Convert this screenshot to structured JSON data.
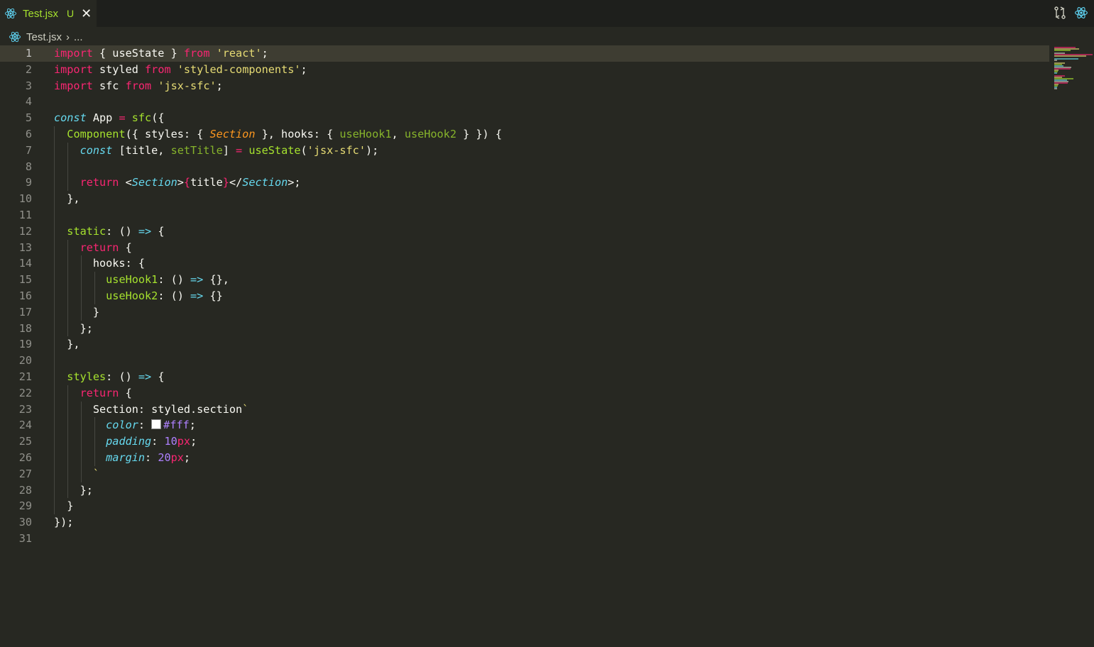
{
  "tab": {
    "file_name": "Test.jsx",
    "status": "U",
    "close_glyph": "✕",
    "icon": "react-icon"
  },
  "breadcrumb": {
    "file_name": "Test.jsx",
    "separator": "›",
    "more": "..."
  },
  "top_actions": [
    {
      "icon": "source-control-compare-icon"
    },
    {
      "icon": "react-icon"
    }
  ],
  "editor": {
    "current_line": 1,
    "lines": [
      {
        "n": "1",
        "tokens": [
          [
            "k",
            "import"
          ],
          [
            "p",
            " { useState } "
          ],
          [
            "k",
            "from"
          ],
          [
            "p",
            " "
          ],
          [
            "s",
            "'react'"
          ],
          [
            "p",
            ";"
          ]
        ]
      },
      {
        "n": "2",
        "tokens": [
          [
            "k",
            "import"
          ],
          [
            "p",
            " styled "
          ],
          [
            "k",
            "from"
          ],
          [
            "p",
            " "
          ],
          [
            "s",
            "'styled-components'"
          ],
          [
            "p",
            ";"
          ]
        ]
      },
      {
        "n": "3",
        "tokens": [
          [
            "k",
            "import"
          ],
          [
            "p",
            " sfc "
          ],
          [
            "k",
            "from"
          ],
          [
            "p",
            " "
          ],
          [
            "s",
            "'jsx-sfc'"
          ],
          [
            "p",
            ";"
          ]
        ]
      },
      {
        "n": "4",
        "tokens": []
      },
      {
        "n": "5",
        "tokens": [
          [
            "c",
            "const"
          ],
          [
            "p",
            " App "
          ],
          [
            "k",
            "="
          ],
          [
            "p",
            " "
          ],
          [
            "gr",
            "sfc"
          ],
          [
            "p",
            "({"
          ]
        ]
      },
      {
        "n": "6",
        "tokens": [
          [
            "p",
            "  "
          ],
          [
            "gr",
            "Component"
          ],
          [
            "p",
            "({ styles: { "
          ],
          [
            "o",
            "Section"
          ],
          [
            "p",
            " }, hooks: { "
          ],
          [
            "g",
            "useHook1"
          ],
          [
            "p",
            ", "
          ],
          [
            "g",
            "useHook2"
          ],
          [
            "p",
            " }"
          ],
          [
            "p",
            " }) {"
          ]
        ]
      },
      {
        "n": "7",
        "tokens": [
          [
            "p",
            "    "
          ],
          [
            "c",
            "const"
          ],
          [
            "p",
            " [title, "
          ],
          [
            "g",
            "setTitle"
          ],
          [
            "p",
            "] "
          ],
          [
            "k",
            "="
          ],
          [
            "p",
            " "
          ],
          [
            "gr",
            "useState"
          ],
          [
            "p",
            "("
          ],
          [
            "s",
            "'jsx-sfc'"
          ],
          [
            "p",
            ");"
          ]
        ]
      },
      {
        "n": "8",
        "tokens": []
      },
      {
        "n": "9",
        "tokens": [
          [
            "p",
            "    "
          ],
          [
            "k",
            "return"
          ],
          [
            "p",
            " <"
          ],
          [
            "c",
            "Section"
          ],
          [
            "p",
            ">"
          ],
          [
            "br",
            "{"
          ],
          [
            "p",
            "title"
          ],
          [
            "br",
            "}"
          ],
          [
            "p",
            "</"
          ],
          [
            "c",
            "Section"
          ],
          [
            "p",
            ">;"
          ]
        ]
      },
      {
        "n": "10",
        "tokens": [
          [
            "p",
            "  },"
          ]
        ]
      },
      {
        "n": "11",
        "tokens": []
      },
      {
        "n": "12",
        "tokens": [
          [
            "p",
            "  "
          ],
          [
            "gr",
            "static"
          ],
          [
            "p",
            ": () "
          ],
          [
            "cy",
            "=>"
          ],
          [
            "p",
            " {"
          ]
        ]
      },
      {
        "n": "13",
        "tokens": [
          [
            "p",
            "    "
          ],
          [
            "k",
            "return"
          ],
          [
            "p",
            " {"
          ]
        ]
      },
      {
        "n": "14",
        "tokens": [
          [
            "p",
            "      hooks: {"
          ]
        ]
      },
      {
        "n": "15",
        "tokens": [
          [
            "p",
            "        "
          ],
          [
            "gr",
            "useHook1"
          ],
          [
            "p",
            ": () "
          ],
          [
            "cy",
            "=>"
          ],
          [
            "p",
            " {},"
          ]
        ]
      },
      {
        "n": "16",
        "tokens": [
          [
            "p",
            "        "
          ],
          [
            "gr",
            "useHook2"
          ],
          [
            "p",
            ": () "
          ],
          [
            "cy",
            "=>"
          ],
          [
            "p",
            " {}"
          ]
        ]
      },
      {
        "n": "17",
        "tokens": [
          [
            "p",
            "      }"
          ]
        ]
      },
      {
        "n": "18",
        "tokens": [
          [
            "p",
            "    };"
          ]
        ]
      },
      {
        "n": "19",
        "tokens": [
          [
            "p",
            "  },"
          ]
        ]
      },
      {
        "n": "20",
        "tokens": []
      },
      {
        "n": "21",
        "tokens": [
          [
            "p",
            "  "
          ],
          [
            "gr",
            "styles"
          ],
          [
            "p",
            ": () "
          ],
          [
            "cy",
            "=>"
          ],
          [
            "p",
            " {"
          ]
        ]
      },
      {
        "n": "22",
        "tokens": [
          [
            "p",
            "    "
          ],
          [
            "k",
            "return"
          ],
          [
            "p",
            " {"
          ]
        ]
      },
      {
        "n": "23",
        "tokens": [
          [
            "p",
            "      Section: styled.section"
          ],
          [
            "s",
            "`"
          ]
        ]
      },
      {
        "n": "24",
        "tokens": [
          [
            "p",
            "        "
          ],
          [
            "c",
            "color"
          ],
          [
            "p",
            ": "
          ],
          [
            "swatch",
            ""
          ],
          [
            "n",
            "#fff"
          ],
          [
            "p",
            ";"
          ]
        ]
      },
      {
        "n": "25",
        "tokens": [
          [
            "p",
            "        "
          ],
          [
            "c",
            "padding"
          ],
          [
            "p",
            ": "
          ],
          [
            "n",
            "10"
          ],
          [
            "k",
            "px"
          ],
          [
            "p",
            ";"
          ]
        ]
      },
      {
        "n": "26",
        "tokens": [
          [
            "p",
            "        "
          ],
          [
            "c",
            "margin"
          ],
          [
            "p",
            ": "
          ],
          [
            "n",
            "20"
          ],
          [
            "k",
            "px"
          ],
          [
            "p",
            ";"
          ]
        ]
      },
      {
        "n": "27",
        "tokens": [
          [
            "p",
            "      "
          ],
          [
            "s",
            "`"
          ]
        ]
      },
      {
        "n": "28",
        "tokens": [
          [
            "p",
            "    };"
          ]
        ]
      },
      {
        "n": "29",
        "tokens": [
          [
            "p",
            "  }"
          ]
        ]
      },
      {
        "n": "30",
        "tokens": [
          [
            "p",
            "});"
          ]
        ]
      },
      {
        "n": "31",
        "tokens": []
      }
    ]
  },
  "colors": {
    "background": "#272822",
    "tabbar": "#1e1f1c",
    "keyword": "#f92672",
    "string": "#e6db74",
    "function": "#a6e22e",
    "type": "#66d9ef",
    "param": "#fd971f",
    "number": "#ae81ff"
  }
}
